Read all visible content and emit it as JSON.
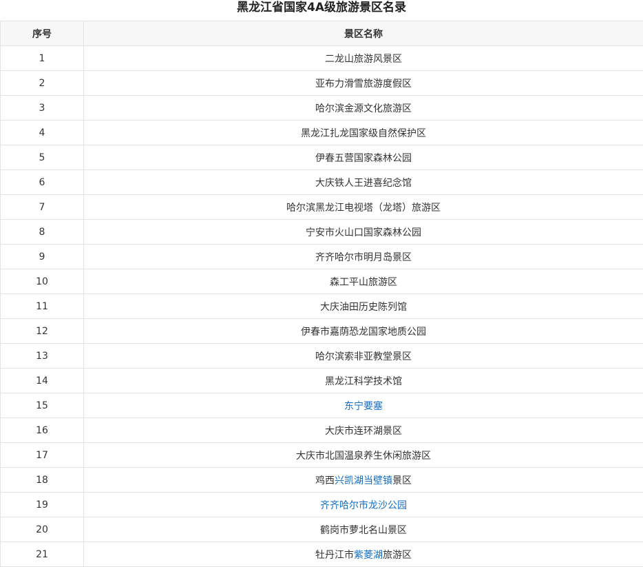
{
  "title": "黑龙江省国家4A级旅游景区名录",
  "headers": {
    "num": "序号",
    "name": "景区名称"
  },
  "link_color": "#136ec2",
  "rows": [
    {
      "num": "1",
      "parts": [
        {
          "text": "二龙山旅游风景区",
          "link": false
        }
      ]
    },
    {
      "num": "2",
      "parts": [
        {
          "text": "亚布力滑雪旅游度假区",
          "link": false
        }
      ]
    },
    {
      "num": "3",
      "parts": [
        {
          "text": "哈尔滨金源文化旅游区",
          "link": false
        }
      ]
    },
    {
      "num": "4",
      "parts": [
        {
          "text": "黑龙江扎龙国家级自然保护区",
          "link": false
        }
      ]
    },
    {
      "num": "5",
      "parts": [
        {
          "text": "伊春五营国家森林公园",
          "link": false
        }
      ]
    },
    {
      "num": "6",
      "parts": [
        {
          "text": "大庆铁人王进喜纪念馆",
          "link": false
        }
      ]
    },
    {
      "num": "7",
      "parts": [
        {
          "text": "哈尔滨黑龙江电视塔（龙塔）旅游区",
          "link": false
        }
      ]
    },
    {
      "num": "8",
      "parts": [
        {
          "text": "宁安市火山口国家森林公园",
          "link": false
        }
      ]
    },
    {
      "num": "9",
      "parts": [
        {
          "text": "齐齐哈尔市明月岛景区",
          "link": false
        }
      ]
    },
    {
      "num": "10",
      "parts": [
        {
          "text": "森工平山旅游区",
          "link": false
        }
      ]
    },
    {
      "num": "11",
      "parts": [
        {
          "text": "大庆油田历史陈列馆",
          "link": false
        }
      ]
    },
    {
      "num": "12",
      "parts": [
        {
          "text": "伊春市嘉荫恐龙国家地质公园",
          "link": false
        }
      ]
    },
    {
      "num": "13",
      "parts": [
        {
          "text": "哈尔滨索非亚教堂景区",
          "link": false
        }
      ]
    },
    {
      "num": "14",
      "parts": [
        {
          "text": "黑龙江科学技术馆",
          "link": false
        }
      ]
    },
    {
      "num": "15",
      "parts": [
        {
          "text": "东宁要塞",
          "link": true
        }
      ]
    },
    {
      "num": "16",
      "parts": [
        {
          "text": "大庆市连环湖景区",
          "link": false
        }
      ]
    },
    {
      "num": "17",
      "parts": [
        {
          "text": "大庆市北国温泉养生休闲旅游区",
          "link": false
        }
      ]
    },
    {
      "num": "18",
      "parts": [
        {
          "text": "鸡西",
          "link": false
        },
        {
          "text": "兴凯湖当壁镇",
          "link": true
        },
        {
          "text": "景区",
          "link": false
        }
      ]
    },
    {
      "num": "19",
      "parts": [
        {
          "text": "齐齐哈尔市龙沙公园",
          "link": true
        }
      ]
    },
    {
      "num": "20",
      "parts": [
        {
          "text": "鹤岗市萝北名山景区",
          "link": false
        }
      ]
    },
    {
      "num": "21",
      "parts": [
        {
          "text": "牡丹江市",
          "link": false
        },
        {
          "text": "紫菱湖",
          "link": true
        },
        {
          "text": "旅游区",
          "link": false
        }
      ]
    }
  ]
}
